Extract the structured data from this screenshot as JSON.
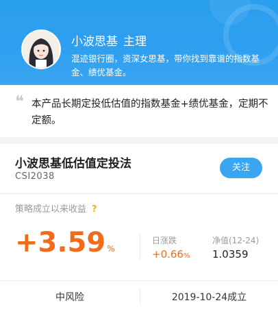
{
  "manager": {
    "name": "小波思基",
    "role": "主理",
    "description": "混迹银行圈，资深女思基，带你找到靠谱的指数基金、绩优基金。"
  },
  "quote": {
    "text": "本产品长期定投低估值的指数基金+绩优基金，定期不定额。"
  },
  "fund": {
    "name": "小波思基低估值定投法",
    "code": "CSI2038",
    "follow_label": "关注",
    "return_label": "策略成立以来收益",
    "return_value": "+3.59",
    "return_unit": "%",
    "daily_label": "日涨跌",
    "daily_value": "+0.66",
    "daily_unit": "%",
    "nav_label": "净值(12-24)",
    "nav_value": "1.0359",
    "risk_level": "中风险",
    "established": "2019-10-24成立"
  },
  "colors": {
    "banner_blue": "#2f9ff0",
    "button_blue": "#3aa6f1",
    "gain_orange": "#f06c1a",
    "help_yellow": "#f0b019"
  },
  "icons": {
    "quote": "quote-mark-icon",
    "help": "question-mark-icon"
  }
}
